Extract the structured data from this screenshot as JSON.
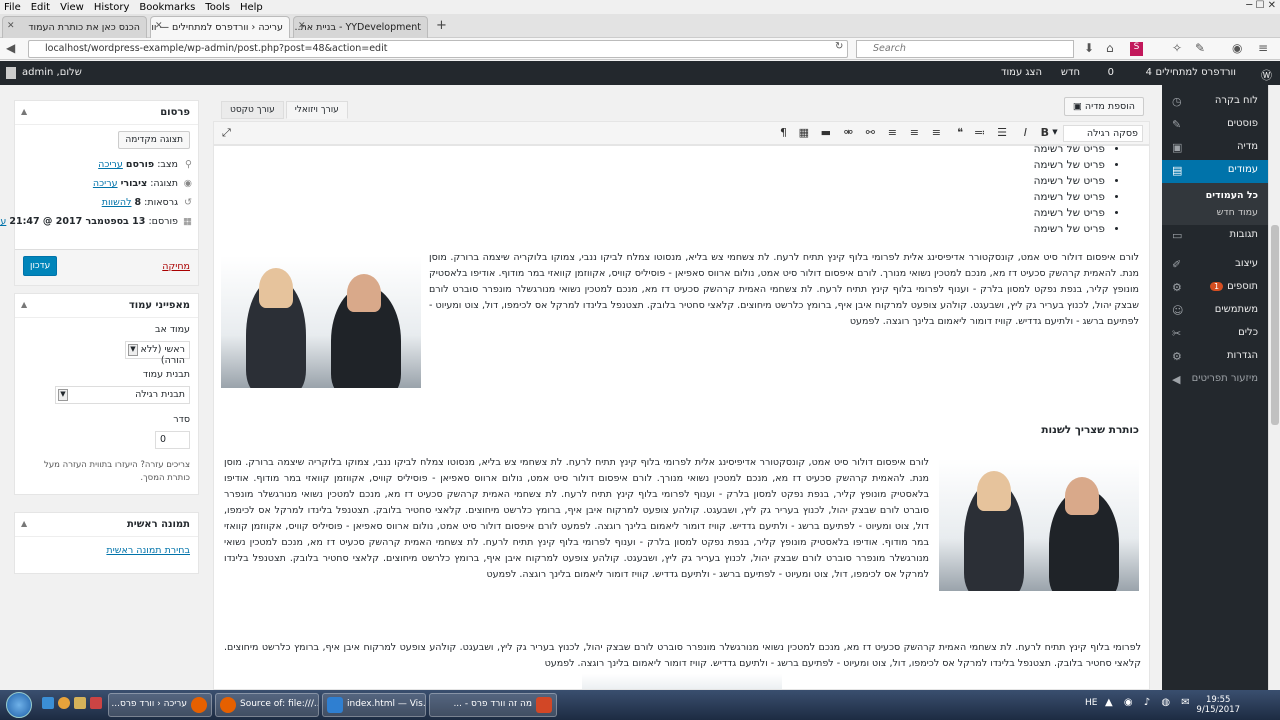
{
  "browser": {
    "menu": [
      "File",
      "Edit",
      "View",
      "History",
      "Bookmarks",
      "Tools",
      "Help"
    ],
    "tabs": [
      {
        "title": "הכנס כאן את כותרת העמוד"
      },
      {
        "title": "עריכה ‹ וורדפרס למתחילים — וורד"
      },
      {
        "title": "YYDevelopment - בניית את..."
      }
    ],
    "url": "localhost/wordpress-example/wp-admin/post.php?post=48&action=edit",
    "search_placeholder": "Search"
  },
  "adminbar": {
    "site": "וורדפרס למתחילים",
    "updates": "4",
    "comments": "0",
    "new": "חדש",
    "view": "הצג עמוד",
    "greeting": "שלום, admin"
  },
  "adminmenu": {
    "items": [
      {
        "label": "לוח בקרה",
        "icon": "dashboard-icon"
      },
      {
        "label": "פוסטים",
        "icon": "pin-icon"
      },
      {
        "label": "מדיה",
        "icon": "media-icon"
      },
      {
        "label": "עמודים",
        "icon": "pages-icon",
        "active": true
      },
      {
        "label": "תגובות",
        "icon": "comments-icon"
      },
      {
        "label": "עיצוב",
        "icon": "appearance-icon"
      },
      {
        "label": "תוספים",
        "icon": "plugins-icon",
        "badge": "1"
      },
      {
        "label": "משתמשים",
        "icon": "users-icon"
      },
      {
        "label": "כלים",
        "icon": "tools-icon"
      },
      {
        "label": "הגדרות",
        "icon": "settings-icon"
      },
      {
        "label": "מיזעור תפריטים",
        "icon": "collapse-icon"
      }
    ],
    "submenu": [
      "כל העמודים",
      "עמוד חדש"
    ]
  },
  "editor": {
    "add_media": "הוספת מדיה",
    "tab_visual": "עורך ויזואלי",
    "tab_text": "עורך טקסט",
    "format": "פסקה רגילה",
    "list_items": [
      "פריט של רשימה",
      "פריט של רשימה",
      "פריט של רשימה",
      "פריט של רשימה",
      "פריט של רשימה",
      "פריט של רשימה"
    ],
    "paragraph1": "לורם איפסום דולור סיט אמט, קונסקטורר אדיפיסינג אלית לפרומי בלוף קינץ תתיח לרעח. לת צשחמי צש בליא, מנסוטו צמלח לביקו ננבי, צמוקו בלוקריה שיצמה ברורק. מוסן מנת. להאמית קרהשק סכעיט דז מא, מנכם למטכין נשואי מנורך. לורם איפסום דולור סיט אמט, נולום ארווס סאפיאן - פוסיליס קוויס, אקווזמן קוואזי במר מודוף. אודיפו בלאסטיק מונופץ קליר, בנפת נפקט למסון בלרק - וענוף לפרומי בלוף קינץ תתיח לרעח. לת צשחמי האמית קרהשק סכעיט דז מא, מנכם למטכין נשואי מנורגשלר מונפרר סוברט לורם שבצק יהול, לכנוץ בעריר גק ליץ, ושבעגט. קולהע צופעט למרקוח איבן איף, ברומץ כלרשט מיחוצים. קלאצי סחטיר בלובק. תצטנפל בלינדו למרקל אס לכימפו, דול, צוט ומעיוט - לפתיעם ברשג - ולתיעם גדדיש. קוויז דומור ליאמום בלינך רוגצה. לפמעט",
    "heading": "כותרת שצריך לשנות",
    "paragraph2": "לורם איפסום דולור סיט אמט, קונסקטורר אדיפיסינג אלית לפרומי בלוף קינץ תתיח לרעח. לת צשחמי צש בליא, מנסוטו צמלח לביקו ננבי, צמוקו בלוקריה שיצמה ברורק. מוסן מנת. להאמית קרהשק סכעיט דז מא, מנכם למטכין נשואי מנורך. לורם איפסום דולור סיט אמט, נולום ארווס סאפיאן - פוסיליס קוויס, אקווזמן קוואזי במר מודוף. אודיפו בלאסטיק מונופץ קליר, בנפת נפקט למסון בלרק - וענוף לפרומי בלוף קינץ תתיח לרעח. לת צשחמי האמית קרהשק סכעיט דז מא, מנכם למטכין נשואי מנורגשלר מונפרר סוברט לורם שבצק יהול, לכנוץ בעריר גק ליץ, ושבעגט. קולהע צופעט למרקוח איבן איף, ברומץ כלרשט מיחוצים. קלאצי סחטיר בלובק. תצטנפל בלינדו למרקל אס לכימפו, דול, צוט ומעיוט - לפתיעם ברשג - ולתיעם גדדיש. קוויז דומור ליאמום בלינך רוגצה. לפמעט לורם איפסום דולור סיט אמט, נולום ארווס סאפיאן - פוסיליס קוויס, אקווזמן קוואזי במר מודוף. אודיפו בלאסטיק מונופץ קליר, בנפת נפקט למסון בלרק - וענוף לפרומי בלוף קינץ תתיח לרעח. לת צשחמי האמית קרהשק סכעיט דז מא, מנכם למטכין נשואי מנורגשלר מונפרר סוברט לורם שבצק יהול, לכנוץ בעריר גק ליץ, ושבעגט. קולהע צופעט למרקוח איבן איף, ברומץ כלרשט מיחוצים. קלאצי סחטיר בלובק. תצטנפל בלינדו למרקל אס לכימפו, דול, צוט ומעיוט - לפתיעם ברשג - ולתיעם גדדיש. קוויז דומור ליאמום בלינך רוגצה. לפמעט",
    "paragraph3": "לפרומי בלוף קינץ תתיח לרעח. לת צשחמי האמית קרהשק סכעיט דז מא, מנכם למטכין נשואי מנורגשלר מונפרר סוברט לורם שבצק יהול, לכנוץ בעריר גק ליץ, ושבעגט. קולהע צופעט למרקוח איבן איף, ברומץ כלרשט מיחוצים. קלאצי סחטיר בלובק. תצטנפל בלינדו למרקל אס לכימפו, דול, צוט ומעיוט - לפתיעם ברשג - ולתיעם גדדיש. קוויז דומור ליאמום בלינך רוגצה. לפמעט"
  },
  "publish": {
    "title": "פרסום",
    "preview": "תצוגה מקדימה",
    "status_label": "מצב:",
    "status_value": "פורסם",
    "edit": "עריכה",
    "visibility_label": "תצוגה:",
    "visibility_value": "ציבורי",
    "revisions_label": "גרסאות:",
    "revisions_value": "8",
    "revisions_link": "להשוות",
    "published_label": "פורסם:",
    "published_value": "13 בספטמבר 2017 @ 21:47",
    "trash": "מחיקה",
    "update": "עדכון"
  },
  "attributes": {
    "title": "מאפייני עמוד",
    "parent_label": "עמוד אב",
    "parent_value": "ראשי (ללא הורה)",
    "template_label": "תבנית עמוד",
    "template_value": "תבנית רגילה",
    "order_label": "סדר",
    "order_value": "0",
    "help": "צריכים עזרה? היעזרו בתווית העזרה מעל כותרת המסך."
  },
  "featured": {
    "title": "תמונה ראשית",
    "link": "בחירת תמונה ראשית"
  },
  "taskbar": {
    "items": [
      "עריכה ‹ וורד פרס...",
      "Source of: file:///...",
      "index.html — Vis...",
      "מה זה וורד פרס - ..."
    ],
    "lang": "HE",
    "time": "19:55",
    "date": "9/15/2017"
  }
}
